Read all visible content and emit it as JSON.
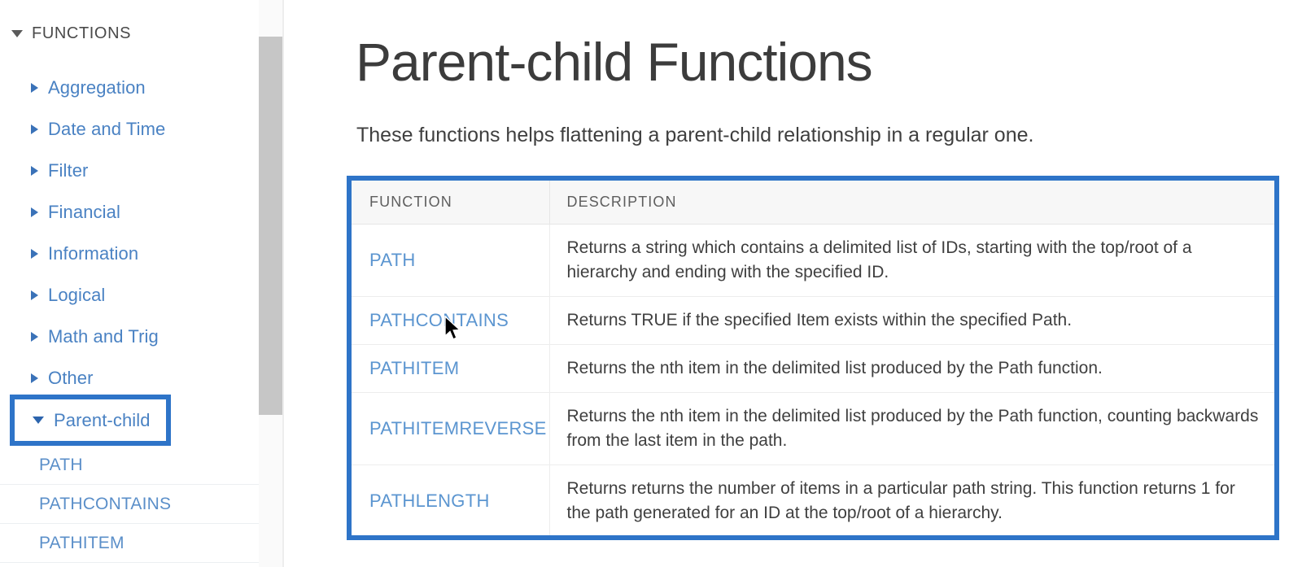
{
  "sidebar": {
    "root": {
      "label": "FUNCTIONS",
      "icon": "caret-down-icon",
      "expanded": true
    },
    "categories": [
      {
        "label": "Aggregation",
        "icon": "caret-right-icon",
        "expanded": false
      },
      {
        "label": "Date and Time",
        "icon": "caret-right-icon",
        "expanded": false
      },
      {
        "label": "Filter",
        "icon": "caret-right-icon",
        "expanded": false
      },
      {
        "label": "Financial",
        "icon": "caret-right-icon",
        "expanded": false
      },
      {
        "label": "Information",
        "icon": "caret-right-icon",
        "expanded": false
      },
      {
        "label": "Logical",
        "icon": "caret-right-icon",
        "expanded": false
      },
      {
        "label": "Math and Trig",
        "icon": "caret-right-icon",
        "expanded": false
      },
      {
        "label": "Other",
        "icon": "caret-right-icon",
        "expanded": false
      }
    ],
    "selected_category": {
      "label": "Parent-child",
      "icon": "caret-down-icon",
      "expanded": true,
      "highlight_color": "#2e74c8"
    },
    "sub_items": [
      {
        "label": "PATH"
      },
      {
        "label": "PATHCONTAINS"
      },
      {
        "label": "PATHITEM"
      }
    ],
    "link_color": "#4a82c3"
  },
  "scrollbar": {
    "orientation": "vertical",
    "thumb_color": "#c6c6c6",
    "track_color": "#fafafa"
  },
  "main": {
    "title": "Parent-child Functions",
    "intro": "These functions helps flattening a parent-child relationship in a regular one."
  },
  "table": {
    "highlight_color": "#2e74c8",
    "columns": [
      "FUNCTION",
      "DESCRIPTION"
    ],
    "rows": [
      {
        "function": "PATH",
        "description": "Returns a string which contains a delimited list of IDs, starting with the top/root of a hierarchy and ending with the specified ID."
      },
      {
        "function": "PATHCONTAINS",
        "description": "Returns TRUE if the specified Item exists within the specified Path."
      },
      {
        "function": "PATHITEM",
        "description": "Returns the nth item in the delimited list produced by the Path function."
      },
      {
        "function": "PATHITEMREVERSE",
        "description": "Returns the nth item in the delimited list produced by the Path function, counting backwards from the last item in the path."
      },
      {
        "function": "PATHLENGTH",
        "description": "Returns returns the number of items in a particular path string. This function returns 1 for the path generated for an ID at the top/root of a hierarchy."
      }
    ]
  },
  "cursor": {
    "icon": "arrow-pointer-icon"
  }
}
